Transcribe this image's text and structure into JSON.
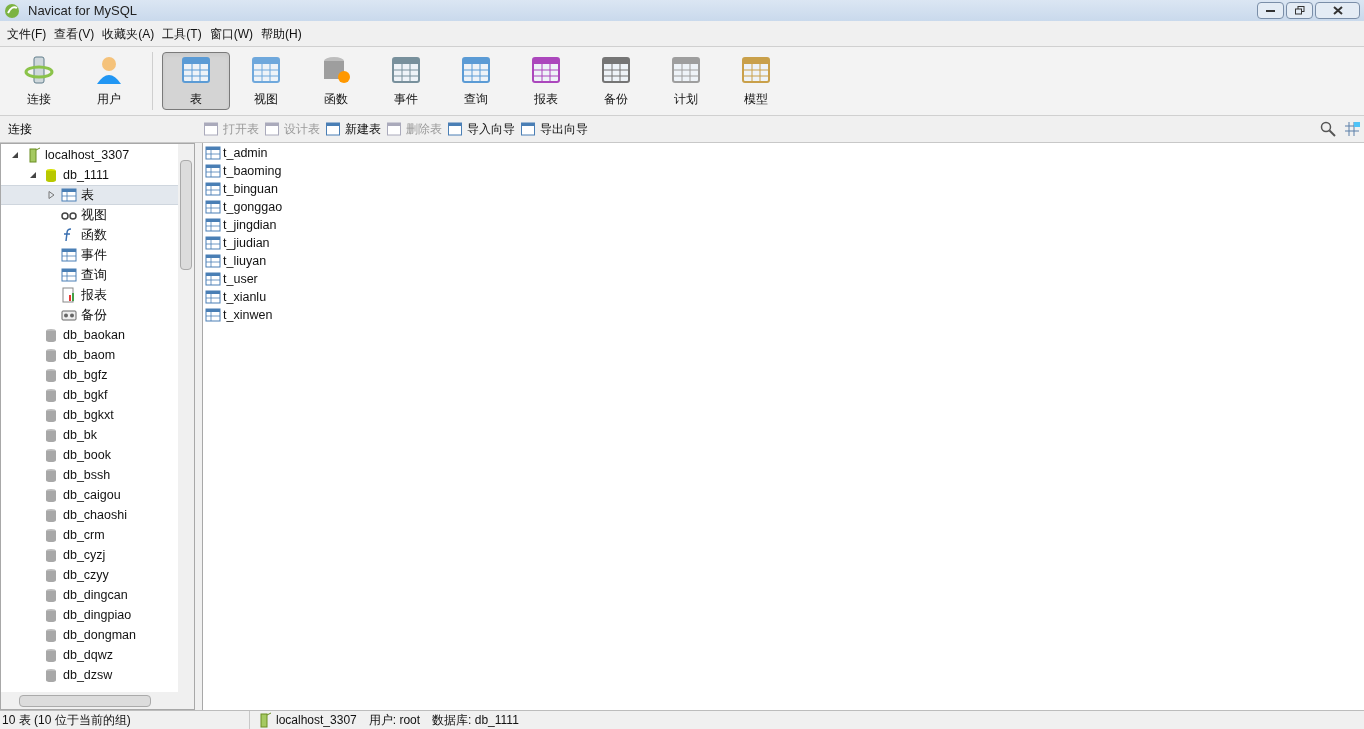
{
  "window": {
    "title": "Navicat for MySQL"
  },
  "menu": [
    "文件(F)",
    "查看(V)",
    "收藏夹(A)",
    "工具(T)",
    "窗口(W)",
    "帮助(H)"
  ],
  "toolbar": [
    {
      "kind": "connection",
      "label": "连接",
      "selected": false
    },
    {
      "kind": "user",
      "label": "用户",
      "selected": false
    },
    {
      "kind": "table",
      "label": "表",
      "selected": true
    },
    {
      "kind": "view",
      "label": "视图",
      "selected": false
    },
    {
      "kind": "function",
      "label": "函数",
      "selected": false
    },
    {
      "kind": "event",
      "label": "事件",
      "selected": false
    },
    {
      "kind": "query",
      "label": "查询",
      "selected": false
    },
    {
      "kind": "report",
      "label": "报表",
      "selected": false
    },
    {
      "kind": "backup",
      "label": "备份",
      "selected": false
    },
    {
      "kind": "schedule",
      "label": "计划",
      "selected": false
    },
    {
      "kind": "model",
      "label": "模型",
      "selected": false
    }
  ],
  "sidebar": {
    "title": "连接",
    "tree": [
      {
        "kind": "connection",
        "label": "localhost_3307",
        "expanded": true,
        "children": [
          {
            "kind": "database",
            "label": "db_1111",
            "open": true,
            "expanded": true,
            "children": [
              {
                "kind": "tables",
                "label": "表",
                "selected": true,
                "expanded": false
              },
              {
                "kind": "views",
                "label": "视图",
                "selected": false
              },
              {
                "kind": "functions",
                "label": "函数",
                "selected": false
              },
              {
                "kind": "events",
                "label": "事件",
                "selected": false
              },
              {
                "kind": "queries",
                "label": "查询",
                "selected": false
              },
              {
                "kind": "reports",
                "label": "报表",
                "selected": false
              },
              {
                "kind": "backups",
                "label": "备份",
                "selected": false
              }
            ]
          },
          {
            "kind": "database",
            "label": "db_baokan",
            "open": false
          },
          {
            "kind": "database",
            "label": "db_baom",
            "open": false
          },
          {
            "kind": "database",
            "label": "db_bgfz",
            "open": false
          },
          {
            "kind": "database",
            "label": "db_bgkf",
            "open": false
          },
          {
            "kind": "database",
            "label": "db_bgkxt",
            "open": false
          },
          {
            "kind": "database",
            "label": "db_bk",
            "open": false
          },
          {
            "kind": "database",
            "label": "db_book",
            "open": false
          },
          {
            "kind": "database",
            "label": "db_bssh",
            "open": false
          },
          {
            "kind": "database",
            "label": "db_caigou",
            "open": false
          },
          {
            "kind": "database",
            "label": "db_chaoshi",
            "open": false
          },
          {
            "kind": "database",
            "label": "db_crm",
            "open": false
          },
          {
            "kind": "database",
            "label": "db_cyzj",
            "open": false
          },
          {
            "kind": "database",
            "label": "db_czyy",
            "open": false
          },
          {
            "kind": "database",
            "label": "db_dingcan",
            "open": false
          },
          {
            "kind": "database",
            "label": "db_dingpiao",
            "open": false
          },
          {
            "kind": "database",
            "label": "db_dongman",
            "open": false
          },
          {
            "kind": "database",
            "label": "db_dqwz",
            "open": false
          },
          {
            "kind": "database",
            "label": "db_dzsw",
            "open": false
          }
        ]
      }
    ]
  },
  "object_toolbar": [
    {
      "label": "打开表",
      "disabled": true
    },
    {
      "label": "设计表",
      "disabled": true
    },
    {
      "label": "新建表",
      "disabled": false
    },
    {
      "label": "删除表",
      "disabled": true
    },
    {
      "label": "导入向导",
      "disabled": false
    },
    {
      "label": "导出向导",
      "disabled": false
    }
  ],
  "tables": [
    "t_admin",
    "t_baoming",
    "t_binguan",
    "t_gonggao",
    "t_jingdian",
    "t_jiudian",
    "t_liuyan",
    "t_user",
    "t_xianlu",
    "t_xinwen"
  ],
  "status_bar": {
    "summary": "10 表 (10 位于当前的组)",
    "connection": "localhost_3307",
    "user": "用户: root",
    "database": "数据库: db_1111"
  }
}
